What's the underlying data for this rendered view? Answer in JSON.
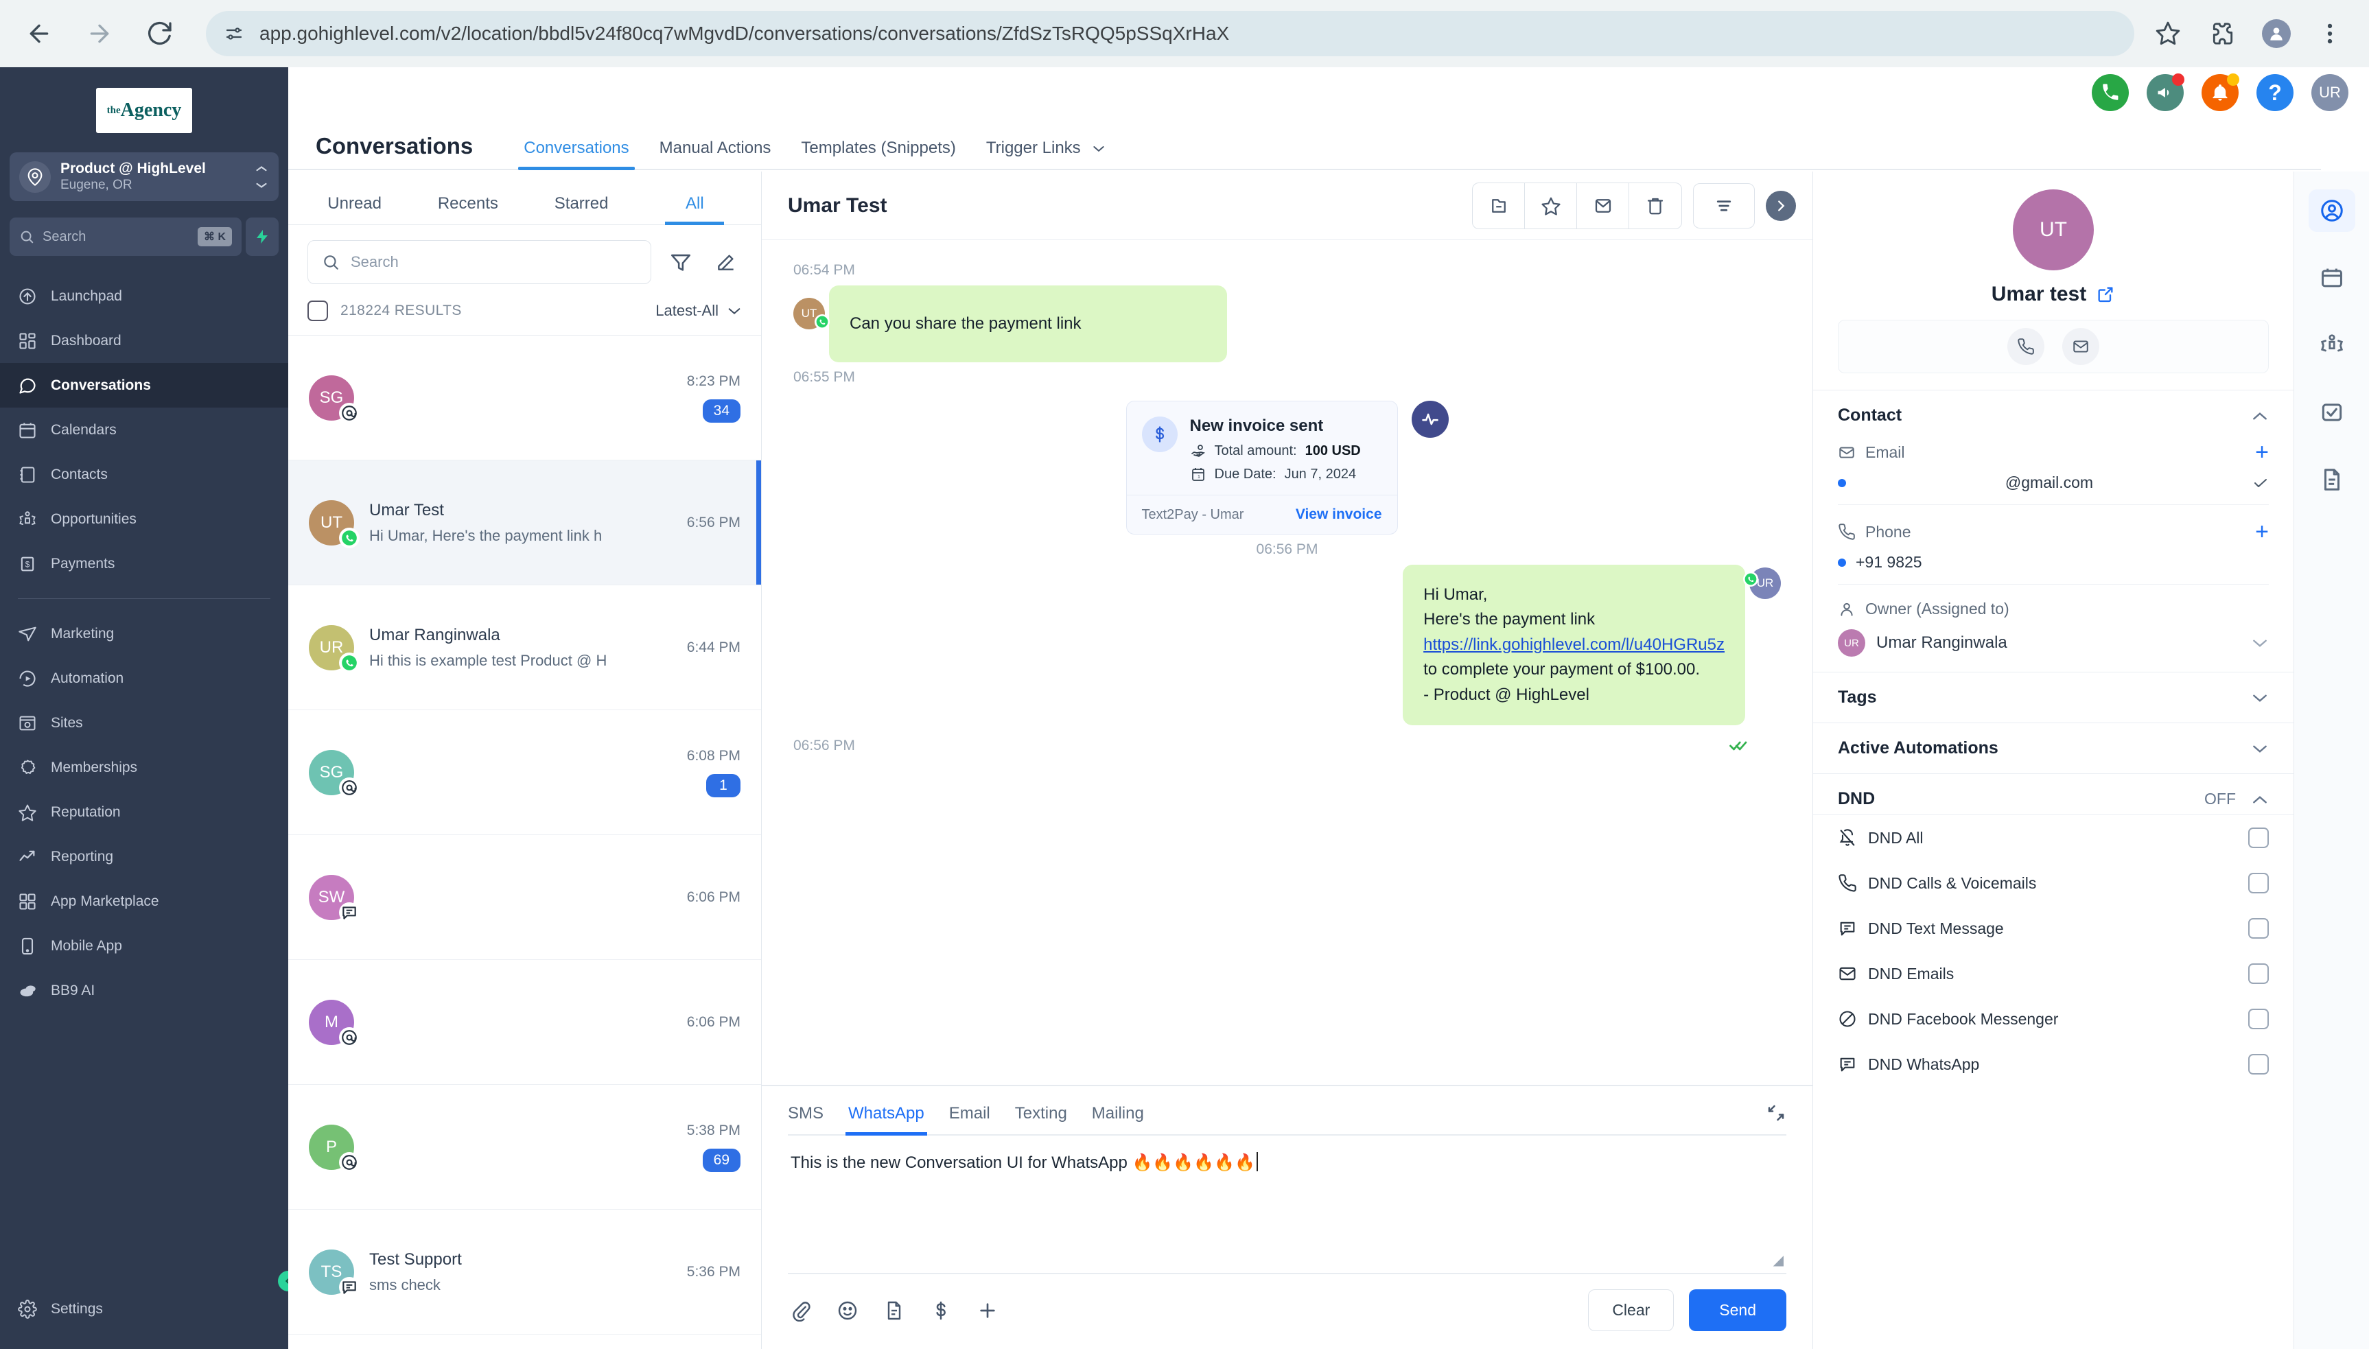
{
  "browser": {
    "url": "app.gohighlevel.com/v2/location/bbdl5v24f80cq7wMgvdD/conversations/conversations/ZfdSzTsRQQ5pSSqXrHaX",
    "back_icon": "back-arrow-icon",
    "forward_icon": "forward-arrow-icon",
    "reload_icon": "reload-icon",
    "site_info_icon": "site-settings-icon",
    "bookmark_icon": "star-icon",
    "extensions_icon": "extensions-icon",
    "profile_icon": "profile-avatar",
    "menu_icon": "kebab-menu-icon"
  },
  "sidebar": {
    "logo_the": "the",
    "logo_agency": "Agency",
    "location": {
      "name": "Product @ HighLevel",
      "sub": "Eugene, OR"
    },
    "search": {
      "placeholder": "Search",
      "shortcut": "⌘ K"
    },
    "items": [
      {
        "label": "Launchpad",
        "icon": "launchpad-icon"
      },
      {
        "label": "Dashboard",
        "icon": "dashboard-icon"
      },
      {
        "label": "Conversations",
        "icon": "conversations-icon",
        "active": true
      },
      {
        "label": "Calendars",
        "icon": "calendar-icon"
      },
      {
        "label": "Contacts",
        "icon": "contacts-icon"
      },
      {
        "label": "Opportunities",
        "icon": "opportunities-icon"
      },
      {
        "label": "Payments",
        "icon": "payments-icon"
      }
    ],
    "items2": [
      {
        "label": "Marketing",
        "icon": "marketing-icon"
      },
      {
        "label": "Automation",
        "icon": "automation-icon"
      },
      {
        "label": "Sites",
        "icon": "sites-icon"
      },
      {
        "label": "Memberships",
        "icon": "memberships-icon"
      },
      {
        "label": "Reputation",
        "icon": "reputation-icon"
      },
      {
        "label": "Reporting",
        "icon": "reporting-icon"
      },
      {
        "label": "App Marketplace",
        "icon": "app-marketplace-icon"
      },
      {
        "label": "Mobile App",
        "icon": "mobile-app-icon"
      },
      {
        "label": "BB9 AI",
        "icon": "bb9-ai-icon"
      }
    ],
    "settings": {
      "label": "Settings",
      "icon": "gear-icon"
    }
  },
  "header": {
    "icons": [
      {
        "name": "phone-dialer-icon",
        "color": "#28a745"
      },
      {
        "name": "announcement-icon",
        "color": "#4d8c7e",
        "dot": "#f03030"
      },
      {
        "name": "notifications-bell-icon",
        "color": "#f56400",
        "dot": "#ffc107"
      },
      {
        "name": "help-icon",
        "color": "#2684ef"
      }
    ],
    "avatar_initials": "UR",
    "avatar_color": "#8290ab"
  },
  "page": {
    "title": "Conversations",
    "tabs": [
      {
        "label": "Conversations",
        "active": true
      },
      {
        "label": "Manual Actions",
        "active": false
      },
      {
        "label": "Templates (Snippets)",
        "active": false
      },
      {
        "label": "Trigger Links",
        "active": false,
        "chevron": true
      }
    ]
  },
  "conversation_list": {
    "filters": [
      {
        "label": "Unread",
        "active": false
      },
      {
        "label": "Recents",
        "active": false
      },
      {
        "label": "Starred",
        "active": false
      },
      {
        "label": "All",
        "active": true
      }
    ],
    "search_placeholder": "Search",
    "filter_icon": "funnel-filter-icon",
    "compose_icon": "compose-pencil-icon",
    "results_count": "218224 RESULTS",
    "sort_label": "Latest-All",
    "rows": [
      {
        "initials": "SG",
        "color": "#c0699b",
        "name": "",
        "preview": "",
        "time": "8:23 PM",
        "badge": "34",
        "channel": "email-at-icon",
        "selected": false
      },
      {
        "initials": "UT",
        "color": "#bb9164",
        "name": "Umar Test",
        "preview": "Hi Umar, Here's the payment link h",
        "time": "6:56 PM",
        "badge": "",
        "channel": "whatsapp-icon",
        "selected": true
      },
      {
        "initials": "UR",
        "color": "#c3c071",
        "name": "Umar Ranginwala",
        "preview": "Hi this is example test Product @ H",
        "time": "6:44 PM",
        "badge": "",
        "channel": "whatsapp-icon",
        "selected": false
      },
      {
        "initials": "SG",
        "color": "#6ec3b2",
        "name": "",
        "preview": "",
        "time": "6:08 PM",
        "badge": "1",
        "channel": "email-at-icon",
        "selected": false
      },
      {
        "initials": "SW",
        "color": "#c67cc0",
        "name": "",
        "preview": "",
        "time": "6:06 PM",
        "badge": "",
        "channel": "sms-icon",
        "selected": false
      },
      {
        "initials": "M",
        "color": "#a濃",
        "name": "",
        "preview": "",
        "time": "6:06 PM",
        "badge": "",
        "channel": "email-at-icon",
        "selected": false
      },
      {
        "initials": "P",
        "color": "#76c174",
        "name": "",
        "preview": "",
        "time": "5:38 PM",
        "badge": "69",
        "channel": "email-at-icon",
        "selected": false
      },
      {
        "initials": "TS",
        "color": "#7cc0c2",
        "name": "Test Support",
        "preview": "sms check",
        "time": "5:36 PM",
        "badge": "",
        "channel": "sms-icon",
        "selected": false
      }
    ]
  },
  "thread": {
    "title": "Umar Test",
    "tools": [
      {
        "name": "archive-folder-icon"
      },
      {
        "name": "star-icon"
      },
      {
        "name": "mark-unread-envelope-icon"
      },
      {
        "name": "delete-trash-icon"
      }
    ],
    "filter_tool": "filter-lines-icon",
    "collapse_tool": "chevron-right-circle-icon",
    "messages": [
      {
        "type": "timestamp",
        "text": "06:54 PM",
        "align": "left"
      },
      {
        "type": "bubble",
        "direction": "in",
        "text": "Can you share the payment link",
        "initials": "UT",
        "avatar_color": "#bb9164",
        "channel": "whatsapp-icon"
      },
      {
        "type": "timestamp",
        "text": "06:55 PM",
        "align": "left"
      },
      {
        "type": "invoice",
        "title": "New invoice sent",
        "amount_label": "Total amount:",
        "amount_value": "100 USD",
        "due_label": "Due Date:",
        "due_value": "Jun 7, 2024",
        "footer_left": "Text2Pay - Umar",
        "footer_right": "View invoice"
      },
      {
        "type": "timestamp",
        "text": "06:56 PM",
        "align": "center"
      },
      {
        "type": "bubble",
        "direction": "out",
        "line1": "Hi Umar,",
        "line2": "Here's the payment link",
        "link": "https://link.gohighlevel.com/l/u40HGRu5z",
        "line3": "to complete your payment of $100.00.",
        "line4": "- Product @ HighLevel",
        "initials": "UR",
        "avatar_color": "#7b84b8",
        "channel": "whatsapp-icon"
      },
      {
        "type": "timestamp",
        "text": "06:56 PM",
        "align": "left",
        "delivered": true
      }
    ]
  },
  "composer": {
    "tabs": [
      {
        "label": "SMS",
        "active": false
      },
      {
        "label": "WhatsApp",
        "active": true
      },
      {
        "label": "Email",
        "active": false
      },
      {
        "label": "Texting",
        "active": false
      },
      {
        "label": "Mailing",
        "active": false
      }
    ],
    "expand_icon": "collapse-diagonal-icon",
    "value": "This is the new Conversation UI for WhatsApp 🔥🔥🔥🔥🔥🔥",
    "footer_icons": [
      {
        "name": "attachment-clip-icon"
      },
      {
        "name": "emoji-smiley-icon"
      },
      {
        "name": "template-document-icon"
      },
      {
        "name": "payment-dollar-icon"
      },
      {
        "name": "add-plus-icon"
      }
    ],
    "clear_label": "Clear",
    "send_label": "Send"
  },
  "contact": {
    "avatar_initials": "UT",
    "avatar_color": "#b473a9",
    "name": "Umar test",
    "open_icon": "external-link-icon",
    "quick_actions": [
      {
        "name": "call-phone-icon"
      },
      {
        "name": "send-email-icon"
      }
    ],
    "sections": {
      "contact": {
        "title": "Contact",
        "email_label": "Email",
        "email_value": "@gmail.com",
        "phone_label": "Phone",
        "phone_value": "+91 9825",
        "owner_label": "Owner (Assigned to)",
        "owner_name": "Umar Ranginwala",
        "owner_initials": "UR"
      },
      "tags": {
        "title": "Tags"
      },
      "automations": {
        "title": "Active Automations"
      },
      "dnd": {
        "title": "DND",
        "state": "OFF",
        "items": [
          {
            "label": "DND All",
            "icon": "bell-off-icon",
            "checked": false
          },
          {
            "label": "DND Calls & Voicemails",
            "icon": "phone-icon",
            "checked": false
          },
          {
            "label": "DND Text Message",
            "icon": "chat-bubble-icon",
            "checked": false
          },
          {
            "label": "DND Emails",
            "icon": "envelope-icon",
            "checked": false
          },
          {
            "label": "DND Facebook Messenger",
            "icon": "no-entry-icon",
            "checked": false
          },
          {
            "label": "DND WhatsApp",
            "icon": "chat-bubble-icon",
            "checked": false
          }
        ]
      }
    }
  },
  "rail": {
    "items": [
      {
        "name": "contact-person-icon",
        "active": true
      },
      {
        "name": "calendar-icon",
        "active": false
      },
      {
        "name": "opportunities-icon",
        "active": false
      },
      {
        "name": "tasks-checkbox-icon",
        "active": false
      },
      {
        "name": "documents-icon",
        "active": false
      }
    ]
  }
}
